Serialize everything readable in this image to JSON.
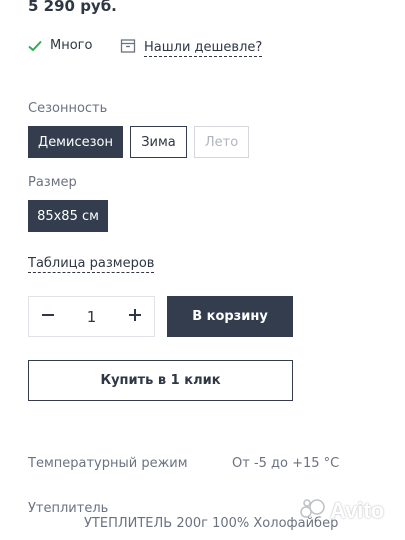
{
  "price": "5 290 руб.",
  "stock": {
    "label": "Много",
    "icon": "check-icon",
    "color": "#2faa55"
  },
  "cheaper": {
    "label": "Нашли дешевле?",
    "icon": "tag-box-icon"
  },
  "seasonality": {
    "label": "Сезонность",
    "options": [
      {
        "label": "Демисезон",
        "state": "selected"
      },
      {
        "label": "Зима",
        "state": "available"
      },
      {
        "label": "Лето",
        "state": "disabled"
      }
    ]
  },
  "size": {
    "label": "Размер",
    "options": [
      {
        "label": "85x85 см",
        "state": "selected"
      }
    ]
  },
  "size_table_link": "Таблица размеров",
  "quantity": {
    "value": "1",
    "minus_icon": "minus-icon",
    "plus_icon": "plus-icon"
  },
  "add_to_cart": "В корзину",
  "buy_one_click": "Купить в 1 клик",
  "properties": [
    {
      "name": "Температурный режим",
      "value": "От -5 до +15 °C"
    },
    {
      "name": "Утеплитель",
      "value": "УТЕПЛИТЕЛЬ 200г 100% Холофайбер"
    }
  ],
  "watermark": {
    "text": "Avito",
    "icon": "avito-logo-icon"
  },
  "colors": {
    "accent_dark": "#333d4d",
    "text": "#2f3744",
    "muted": "#6b7280",
    "disabled": "#b0b5bc",
    "success": "#2faa55"
  }
}
